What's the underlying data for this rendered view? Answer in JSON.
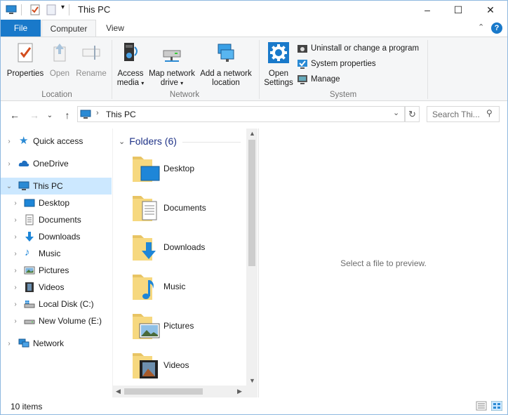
{
  "window": {
    "title": "This PC",
    "controls": {
      "minimize": "–",
      "maximize": "☐",
      "close": "✕"
    }
  },
  "ribbon_tabs": {
    "file": "File",
    "computer": "Computer",
    "view": "View"
  },
  "ribbon": {
    "location": {
      "label": "Location",
      "properties": "Properties",
      "open": "Open",
      "rename": "Rename"
    },
    "network": {
      "label": "Network",
      "access_media_1": "Access",
      "access_media_2": "media",
      "map_drive_1": "Map network",
      "map_drive_2": "drive",
      "add_location_1": "Add a network",
      "add_location_2": "location"
    },
    "system": {
      "label": "System",
      "open_settings_1": "Open",
      "open_settings_2": "Settings",
      "uninstall": "Uninstall or change a program",
      "system_properties": "System properties",
      "manage": "Manage"
    }
  },
  "address": {
    "path": "This PC",
    "search_placeholder": "Search Thi..."
  },
  "nav": {
    "quick_access": "Quick access",
    "onedrive": "OneDrive",
    "this_pc": "This PC",
    "desktop": "Desktop",
    "documents": "Documents",
    "downloads": "Downloads",
    "music": "Music",
    "pictures": "Pictures",
    "videos": "Videos",
    "local_disk": "Local Disk (C:)",
    "new_volume": "New Volume (E:)",
    "network": "Network"
  },
  "content": {
    "group_title": "Folders (6)",
    "folders": [
      "Desktop",
      "Documents",
      "Downloads",
      "Music",
      "Pictures",
      "Videos"
    ]
  },
  "preview": {
    "text": "Select a file to preview."
  },
  "status": {
    "items": "10 items"
  },
  "colors": {
    "accent": "#1979ca",
    "selection": "#cce8ff",
    "group_header": "#1e3287"
  }
}
